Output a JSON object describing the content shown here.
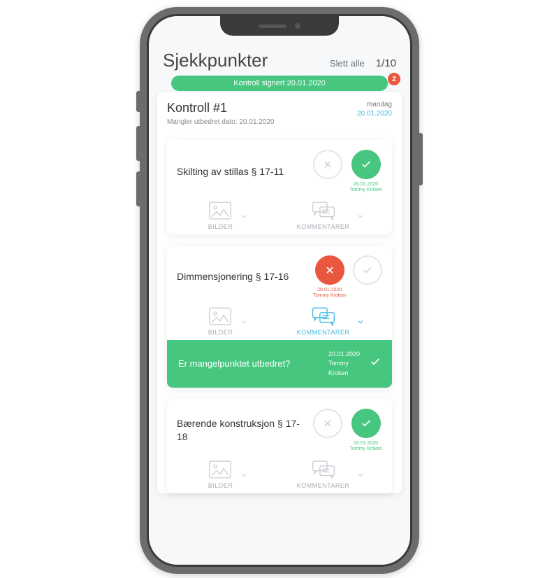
{
  "header": {
    "title": "Sjekkpunkter",
    "delete_all": "Slett alle",
    "counter": "1/10"
  },
  "banner": {
    "text": "Kontroll signert 20.01.2020",
    "badge": "2"
  },
  "control": {
    "title": "Kontroll #1",
    "subtitle": "Mangler utbedret dato: 20.01.2020",
    "day": "mandag",
    "date": "20.01.2020"
  },
  "labels": {
    "images": "BILDER",
    "comments": "KOMMENTARER"
  },
  "fix_bar": {
    "question": "Er mangelpunktet utbedret?",
    "date": "20.01.2020",
    "user_first": "Tommy",
    "user_last": "Kroken"
  },
  "checkpoints": [
    {
      "title": "Skilting av stillas § 17-11",
      "status": "pass",
      "sign_date": "20.01.2020",
      "sign_user": "Tommy Kroken",
      "comments_active": false,
      "has_fix_bar": false
    },
    {
      "title": "Dimmensjonering § 17-16",
      "status": "fail",
      "sign_date": "20.01.2020",
      "sign_user": "Tommy Kroken",
      "comments_active": true,
      "has_fix_bar": true
    },
    {
      "title": "Bærende konstruksjon § 17-18",
      "status": "pass",
      "sign_date": "20.01.2020",
      "sign_user": "Tommy Kroken",
      "comments_active": false,
      "has_fix_bar": false
    }
  ]
}
